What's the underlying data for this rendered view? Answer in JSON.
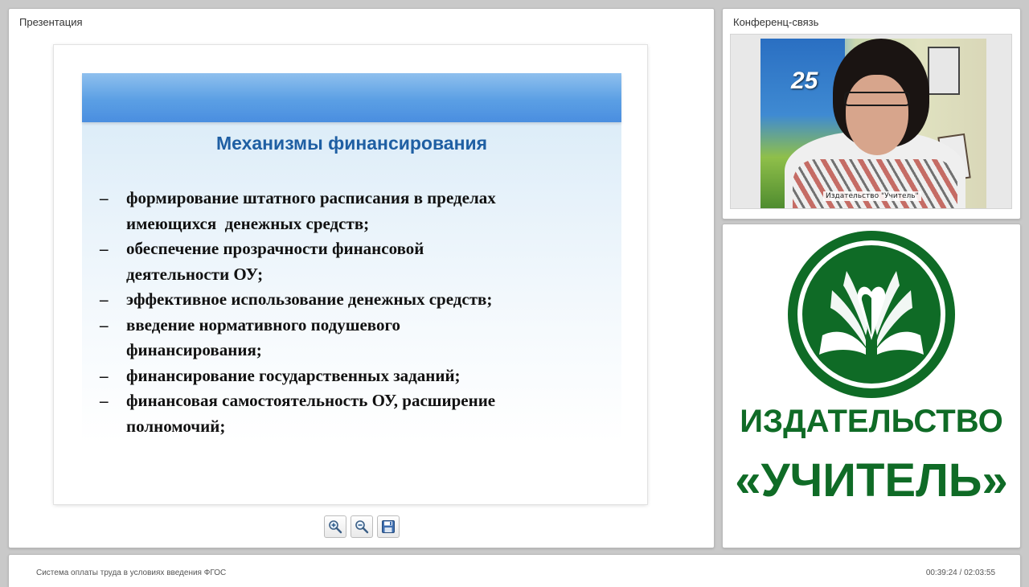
{
  "presentation": {
    "panel_title": "Презентация",
    "slide": {
      "heading": "Механизмы финансирования",
      "bullet_marker": "–",
      "bullets": [
        {
          "lines": [
            "формирование штатного расписания в пределах",
            "имеющихся  денежных средств;"
          ]
        },
        {
          "lines": [
            "обеспечение прозрачности финансовой",
            "деятельности ОУ;"
          ]
        },
        {
          "lines": [
            "эффективное использование денежных средств;"
          ]
        },
        {
          "lines": [
            "введение нормативного подушевого",
            "финансирования;"
          ]
        },
        {
          "lines": [
            "финансирование государственных заданий;"
          ]
        },
        {
          "lines": [
            "финансовая самостоятельность ОУ, расширение",
            "полномочий;"
          ]
        }
      ]
    },
    "toolbar": {
      "zoom_in_icon": "zoom-in-icon",
      "zoom_out_icon": "zoom-out-icon",
      "save_icon": "save-icon"
    }
  },
  "conference": {
    "panel_title": "Конференц-связь",
    "video_caption": "Издательство \"Учитель\"",
    "banner_number": "25"
  },
  "logo": {
    "line1": "ИЗДАТЕЛЬСТВО",
    "line2": "«УЧИТЕЛЬ»",
    "color": "#0f6b26"
  },
  "status": {
    "title": "Система оплаты труда в условиях введения ФГОС",
    "time": "00:39:24 / 02:03:55"
  }
}
